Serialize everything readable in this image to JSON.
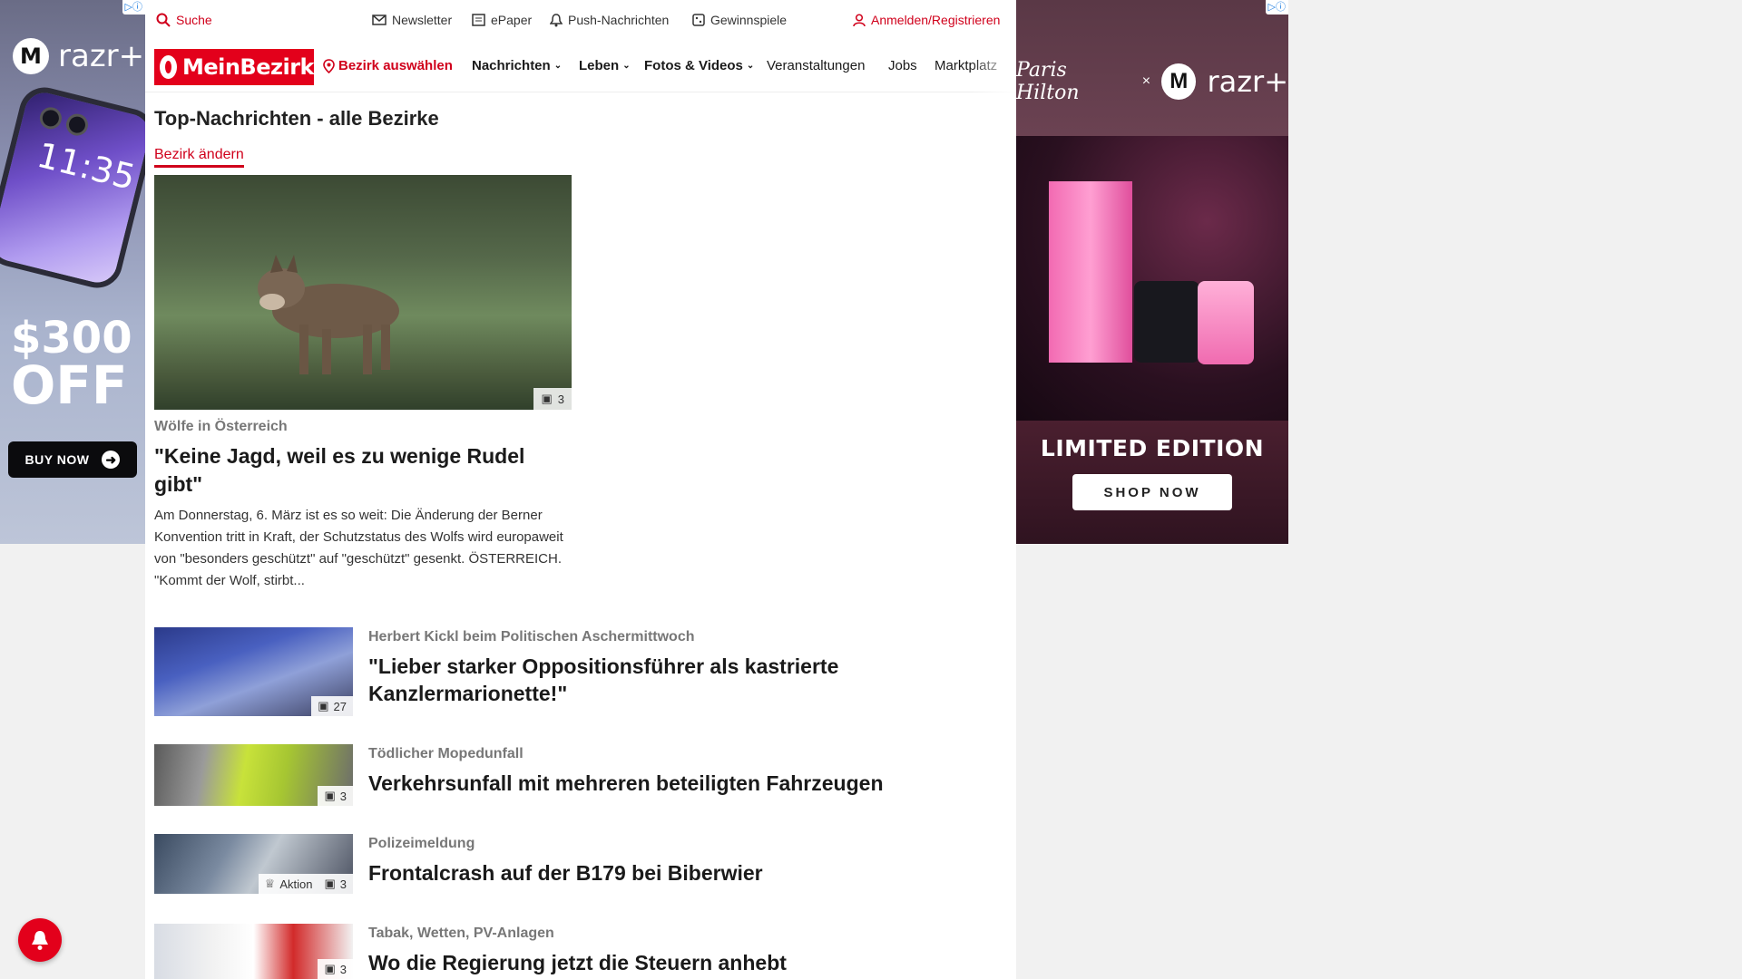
{
  "ad_left": {
    "badge": "▷ⓘ",
    "brand": "razr+",
    "logo_letter": "M",
    "phone_time": "11:35",
    "offer_amount": "$300",
    "offer_word": "OFF",
    "button": "BUY NOW"
  },
  "util_bar": {
    "search": "Suche",
    "newsletter": "Newsletter",
    "epaper": "ePaper",
    "push": "Push-Nachrichten",
    "gewinnspiele": "Gewinnspiele",
    "login": "Anmelden/Registrieren"
  },
  "nav": {
    "logo": "MeinBezirk",
    "bezirk": "Bezirk auswählen",
    "items": [
      "Nachrichten",
      "Leben",
      "Fotos & Videos",
      "Veranstaltungen",
      "Jobs",
      "Marktplatz"
    ]
  },
  "main": {
    "section_title": "Top-Nachrichten - alle Bezirke",
    "change_link": "Bezirk ändern",
    "hero": {
      "image_count": "3",
      "category": "Wölfe in Österreich",
      "title": "\"Keine Jagd, weil es zu wenige Rudel gibt\"",
      "teaser": "Am Donnerstag, 6. März ist es so weit: Die Änderung der Berner Konvention tritt in Kraft, der Schutzstatus des Wolfs wird europaweit von \"besonders geschützt\" auf \"geschützt\" gesenkt.  ÖSTERREICH. \"Kommt der Wolf, stirbt..."
    },
    "articles": [
      {
        "category": "Herbert Kickl beim Politischen Aschermittwoch",
        "title": "\"Lieber starker Oppositionsführer als kastrierte Kanzlermarionette!\"",
        "count": "27",
        "badge": ""
      },
      {
        "category": "Tödlicher Mopedunfall",
        "title": "Verkehrsunfall mit mehreren beteiligten Fahrzeugen",
        "count": "3",
        "badge": ""
      },
      {
        "category": "Polizeimeldung",
        "title": "Frontalcrash auf der B179 bei Biberwier",
        "count": "3",
        "badge": "Aktion"
      },
      {
        "category": "Tabak, Wetten, PV-Anlagen",
        "title": "Wo die Regierung jetzt die Steuern anhebt",
        "count": "3",
        "badge": ""
      }
    ]
  },
  "ad_right": {
    "badge": "▷ⓘ",
    "signature": "Paris Hilton",
    "times": "×",
    "brand": "razr+",
    "logo_letter": "M",
    "headline": "LIMITED EDITION",
    "button": "SHOP NOW"
  },
  "colors": {
    "brand_red": "#e3001b",
    "link_red": "#d0001b"
  },
  "icons": [
    "search-icon",
    "mail-icon",
    "newspaper-icon",
    "bell-icon",
    "gift-icon",
    "user-icon",
    "location-pin-icon",
    "chevron-down-icon",
    "images-icon",
    "trophy-icon"
  ]
}
